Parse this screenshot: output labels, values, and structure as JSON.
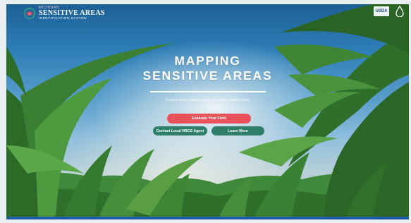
{
  "brand": {
    "small": "MICHIGAN",
    "main": "SENSITIVE AREAS",
    "sub": "IDENTIFICATION SYSTEM"
  },
  "header": {
    "usda_label": "USDA"
  },
  "hero": {
    "title_line1": "MAPPING",
    "title_line2": "SENSITIVE AREAS",
    "tagline": "Evaluate fields, generate reports, and protect sensitive areas"
  },
  "buttons": {
    "evaluate": "Evaluate Your Field",
    "contact": "Contact Local NRCS Agent",
    "learn": "Learn More"
  },
  "colors": {
    "primary_button": "#e8525a",
    "secondary_button": "#2f7e6a",
    "footer": "#1f5aa6"
  },
  "icons": [
    "brand-logo-icon",
    "usda-logo-icon",
    "water-drop-icon"
  ]
}
